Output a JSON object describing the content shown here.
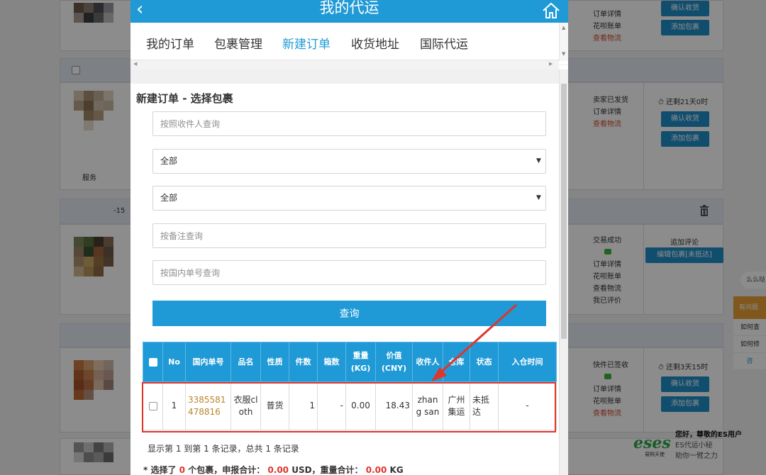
{
  "modal": {
    "back_icon": "chevron-left-icon",
    "title": "我的代运",
    "home_icon": "home-icon",
    "tabs": [
      {
        "label": "我的订单"
      },
      {
        "label": "包裹管理"
      },
      {
        "label": "新建订单",
        "active": true
      },
      {
        "label": "收货地址"
      },
      {
        "label": "国际代运"
      }
    ],
    "section_title": "新建订单 - 选择包裹",
    "filters": {
      "recipient_placeholder": "按照收件人查询",
      "select1_value": "全部",
      "select2_value": "全部",
      "remark_placeholder": "按备注查询",
      "domestic_no_placeholder": "按国内单号查询"
    },
    "query_button": "查询",
    "table": {
      "headers": [
        "No",
        "国内单号",
        "品名",
        "性质",
        "件数",
        "箱数",
        "重量\n(KG)",
        "价值\n(CNY)",
        "收件人",
        "仓库",
        "状态",
        "入仓时间"
      ],
      "rows": [
        {
          "no": "1",
          "domestic_no": "3385581478816",
          "name": "衣服cloth",
          "nature": "普货",
          "pieces": "1",
          "boxes": "-",
          "weight": "0.00",
          "value": "18.43",
          "recipient": "zhang san",
          "warehouse": "广州集运",
          "status": "未抵达",
          "in_time": "-"
        }
      ]
    },
    "summary": "显示第 1 到第 1 条记录，总共 1 条记录",
    "total": {
      "prefix": "* 选择了",
      "count": "0",
      "count_suffix": "个包裹，申报合计：",
      "declared": "0.00",
      "declared_unit": "USD，重量合计：",
      "weight": "0.00",
      "weight_unit": "KG"
    },
    "accent_color": "#1f9ad6",
    "highlight_color": "#e0352b"
  },
  "background": {
    "rows": [
      {
        "status": [
          "订单详情",
          "花呗账单",
          "查看物流"
        ],
        "buttons": [
          "确认收货",
          "添加包裹"
        ]
      },
      {
        "status": [
          "卖家已发货",
          "订单详情",
          "查看物流"
        ],
        "timer": "还剩21天0时",
        "buttons": [
          "确认收货",
          "添加包裹"
        ]
      },
      {
        "status": [
          "交易成功",
          "订单详情",
          "花呗账单",
          "查看物流",
          "我已评价"
        ],
        "action": "追加评论",
        "buttons": [
          "编辑包裹[未抵达]"
        ]
      },
      {
        "status": [
          "快件已签收",
          "订单详情",
          "花呗账单",
          "查看物流"
        ],
        "timer": "还剩3天15时",
        "buttons": [
          "确认收货",
          "添加包裹"
        ]
      }
    ],
    "side_labels": {
      "service": "服务",
      "date": "-15"
    },
    "help": {
      "bubble": "么么哒",
      "head": "有问题",
      "items": [
        "如何查",
        "如何修",
        "咨"
      ]
    },
    "es_badge": {
      "logo": "eses",
      "logo_sub": "易购天使",
      "greeting": "您好，尊敬的ES用户",
      "line1": "ES代运小秘",
      "line2": "助你一臂之力"
    }
  }
}
